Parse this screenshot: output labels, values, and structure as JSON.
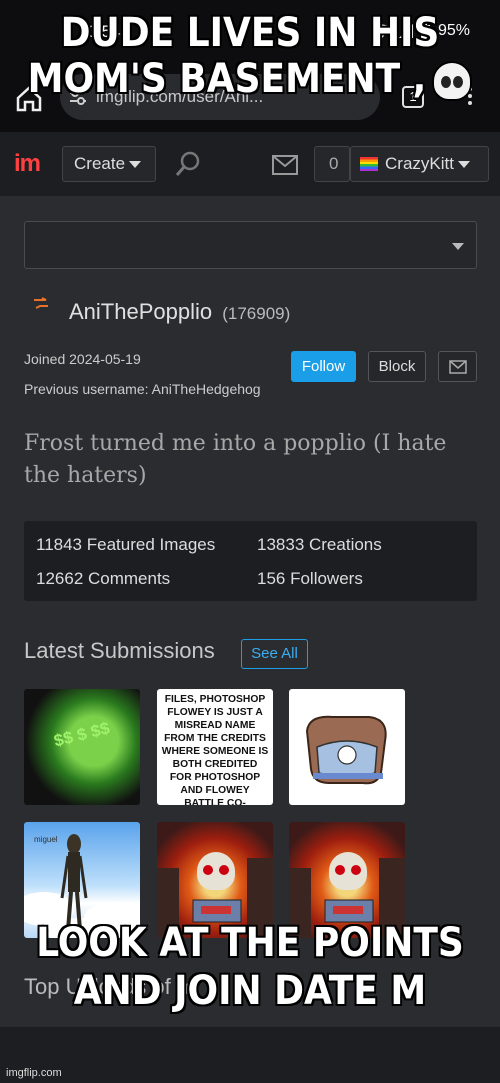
{
  "status": {
    "time": "10:54",
    "battery": "95%"
  },
  "browser": {
    "url": "imgflip.com/user/Ani...",
    "tab_count": "1"
  },
  "nav": {
    "logo": "im",
    "create_label": "Create",
    "notifications": "0",
    "username": "CrazyKitt"
  },
  "profile": {
    "name": "AniThePopplio",
    "points": "(176909)",
    "joined": "Joined 2024-05-19",
    "previous_username": "Previous username: AniTheHedgehog",
    "follow_label": "Follow",
    "block_label": "Block",
    "bio": "Frost turned me into a popplio (I hate the haters)"
  },
  "stats": {
    "featured": "11843 Featured Images",
    "creations": "13833 Creations",
    "comments": "12662 Comments",
    "followers": "156 Followers"
  },
  "submissions": {
    "title": "Latest Submissions",
    "see_all": "See All",
    "thumb2_text": "FILES, PHOTOSHOP FLOWEY IS JUST A MISREAD NAME FROM THE CREDITS WHERE SOMEONE IS BOTH CREDITED FOR PHOTOSHOP AND FLOWEY BATTLE CO-",
    "thumb4_text": "miguel"
  },
  "top_uploads": "Top Uploads of m",
  "meme": {
    "top": "DUDE LIVES IN HIS MOM'S BASEMENT ,",
    "bottom": "LOOK AT THE POINTS AND JOIN DATE M"
  },
  "watermark": "imgflip.com"
}
